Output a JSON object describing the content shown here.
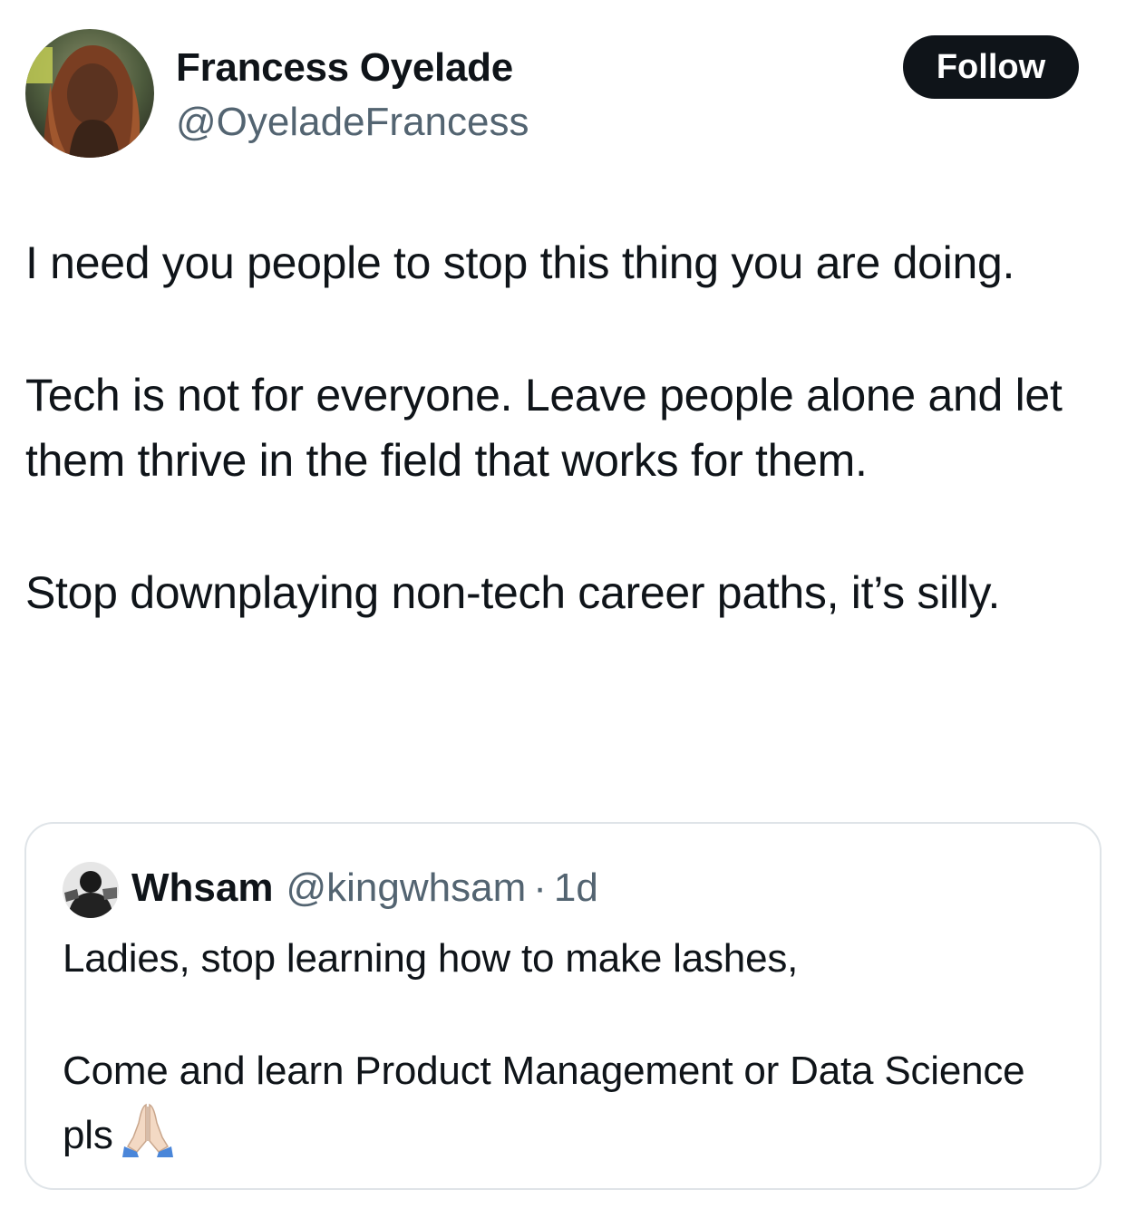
{
  "tweet": {
    "author": {
      "name": "Francess Oyelade",
      "handle": "@OyeladeFrancess",
      "avatar_icon": "profile-photo-avatar"
    },
    "follow_label": "Follow",
    "text": {
      "p1": "I need you people to stop this thing you are doing.",
      "p2": "Tech is not for everyone. Leave people alone and let them thrive in the field that works for them.",
      "p3": "Stop downplaying non-tech career paths, it’s silly."
    }
  },
  "quoted_tweet": {
    "author": {
      "name": "Whsam",
      "handle": "@kingwhsam",
      "avatar_icon": "profile-photo-avatar"
    },
    "separator": "·",
    "time": "1d",
    "text": {
      "p1": "Ladies, stop learning how to make lashes,",
      "p2": "Come and learn Product Management or Data Science pls"
    },
    "emoji_icon": "folded-hands-icon"
  },
  "colors": {
    "text_primary": "#0f1419",
    "text_secondary": "#536471",
    "follow_button_bg": "#0f1419",
    "follow_button_text": "#ffffff",
    "border": "#dfe4e8"
  }
}
